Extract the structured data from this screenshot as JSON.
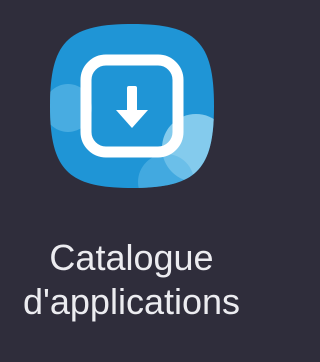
{
  "app": {
    "label_line_1": "Catalogue",
    "label_line_2": "d'applications",
    "icon": "download-arrow-icon"
  },
  "colors": {
    "background": "#2f2d3b",
    "icon_blue": "#1f95d6",
    "icon_light_blue": "#8fd0f0",
    "icon_white": "#ffffff",
    "label": "#ececf0"
  }
}
